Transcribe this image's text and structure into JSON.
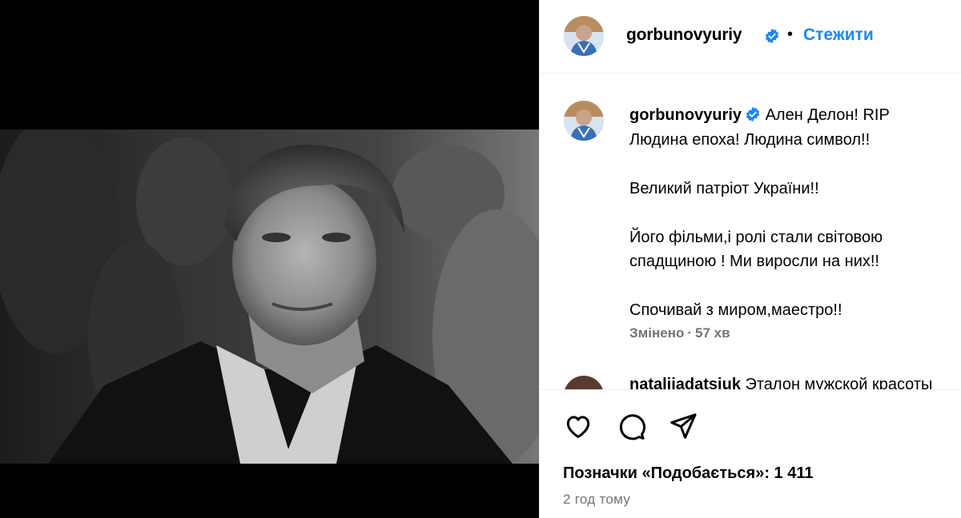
{
  "post": {
    "image_icon": "portrait-photo"
  },
  "header": {
    "username": "gorbunovyuriy",
    "verified_icon": "verified-badge-icon",
    "separator": "•",
    "follow_label": "Стежити"
  },
  "caption": {
    "username": "gorbunovyuriy",
    "first_line": "Ален Делон! RIP",
    "lines": [
      "Людина епоха! Людина символ!!",
      "",
      "Великий патріот України!!",
      "",
      "Його фільми,і ролі стали світовою",
      "спадщиною ! Ми виросли на них!!",
      "",
      "Спочивай з миром,маестро!!"
    ],
    "edited_label": "Змінено",
    "meta_separator": "·",
    "age": "57 хв"
  },
  "next_comment": {
    "username": "natalijadatsiuk",
    "text": "Эталон мужской красоты"
  },
  "actions": {
    "icons": [
      "heart-icon",
      "comment-icon",
      "share-icon"
    ],
    "likes_label": "Позначки «Подобається»: 1 411",
    "posted_time": "2 год тому"
  },
  "colors": {
    "accent_blue": "#1b86f7",
    "muted_gray": "#737373",
    "divider": "#efefef"
  }
}
